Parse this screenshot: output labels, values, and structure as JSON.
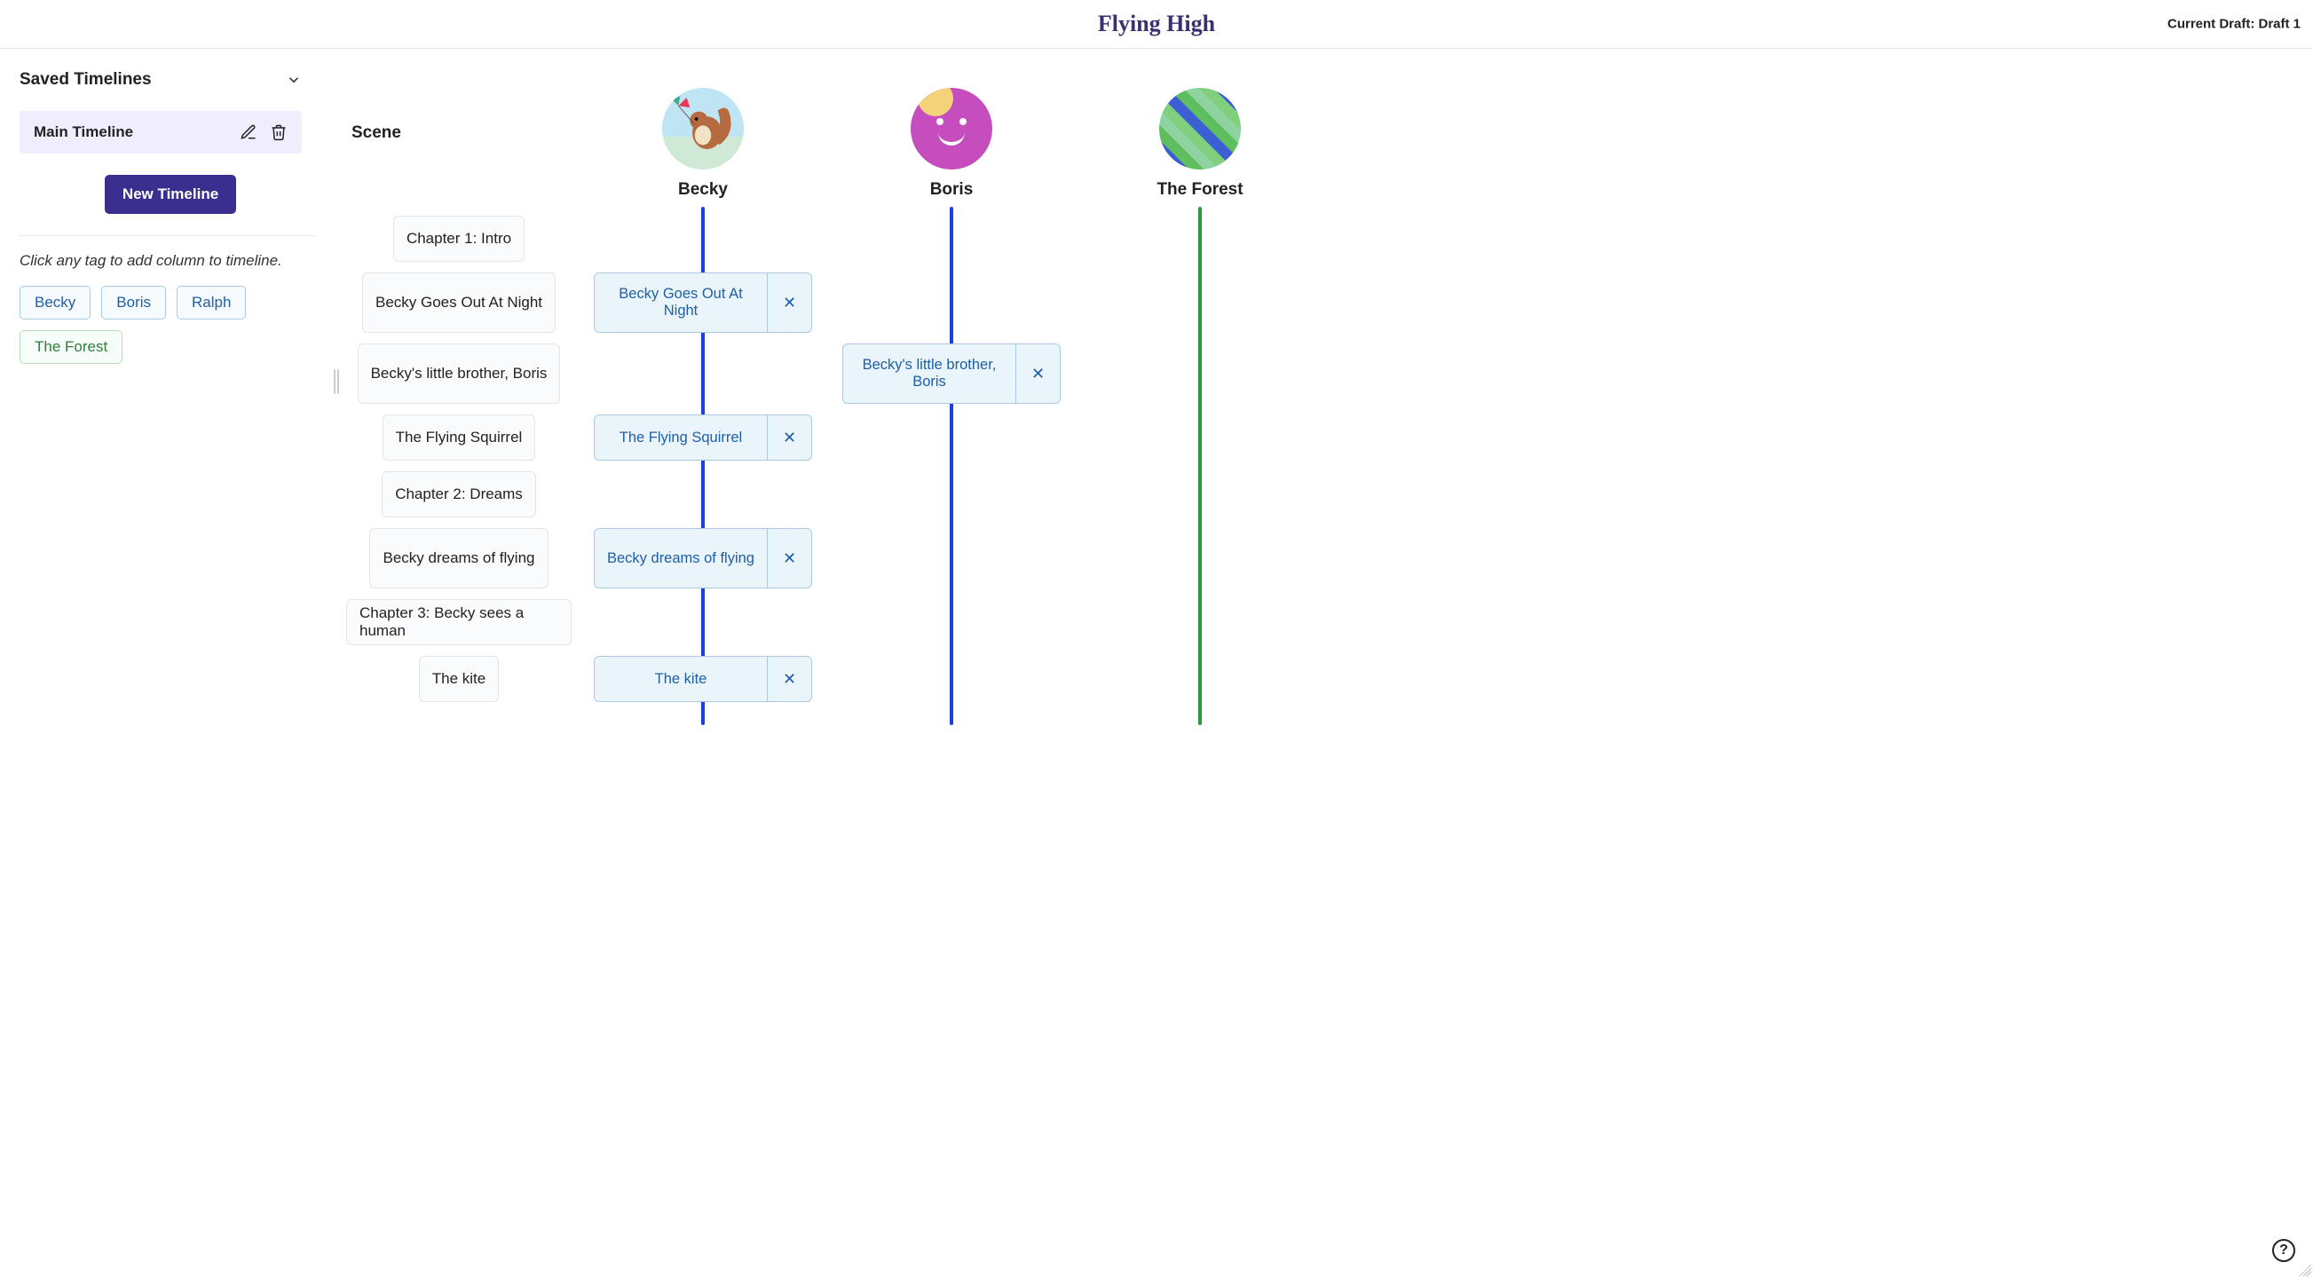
{
  "header": {
    "title": "Flying High",
    "draft_label": "Current Draft: Draft 1"
  },
  "sidebar": {
    "saved_title": "Saved Timelines",
    "timelines": [
      {
        "name": "Main Timeline"
      }
    ],
    "new_button": "New Timeline",
    "hint": "Click any tag to add column to timeline.",
    "tags": [
      {
        "label": "Becky",
        "kind": "char"
      },
      {
        "label": "Boris",
        "kind": "char"
      },
      {
        "label": "Ralph",
        "kind": "char"
      },
      {
        "label": "The Forest",
        "kind": "loc"
      }
    ]
  },
  "timeline": {
    "scene_header": "Scene",
    "columns": [
      {
        "name": "Becky",
        "avatar": "becky",
        "line": "blue"
      },
      {
        "name": "Boris",
        "avatar": "boris",
        "line": "blue"
      },
      {
        "name": "The Forest",
        "avatar": "forest",
        "line": "green"
      }
    ],
    "rows": [
      {
        "scene": "Chapter 1: Intro",
        "h": "row-h52",
        "cells": [
          null,
          null,
          null
        ]
      },
      {
        "scene": "Becky Goes Out At Night",
        "h": "row-h68",
        "cells": [
          "Becky Goes Out At Night",
          null,
          null
        ]
      },
      {
        "scene": "Becky's little brother, Boris",
        "h": "row-h68",
        "cells": [
          null,
          "Becky's little brother, Boris",
          null
        ],
        "drag": true
      },
      {
        "scene": "The Flying Squirrel",
        "h": "row-h52",
        "cells": [
          "The Flying Squirrel",
          null,
          null
        ]
      },
      {
        "scene": "Chapter 2: Dreams",
        "h": "row-h52",
        "cells": [
          null,
          null,
          null
        ]
      },
      {
        "scene": "Becky dreams of flying",
        "h": "row-h68",
        "cells": [
          "Becky dreams of flying",
          null,
          null
        ]
      },
      {
        "scene": "Chapter 3: Becky sees a human",
        "h": "row-h52",
        "cells": [
          null,
          null,
          null
        ]
      },
      {
        "scene": "The kite",
        "h": "row-h52",
        "cells": [
          "The kite",
          null,
          null
        ]
      }
    ]
  },
  "help": "?"
}
